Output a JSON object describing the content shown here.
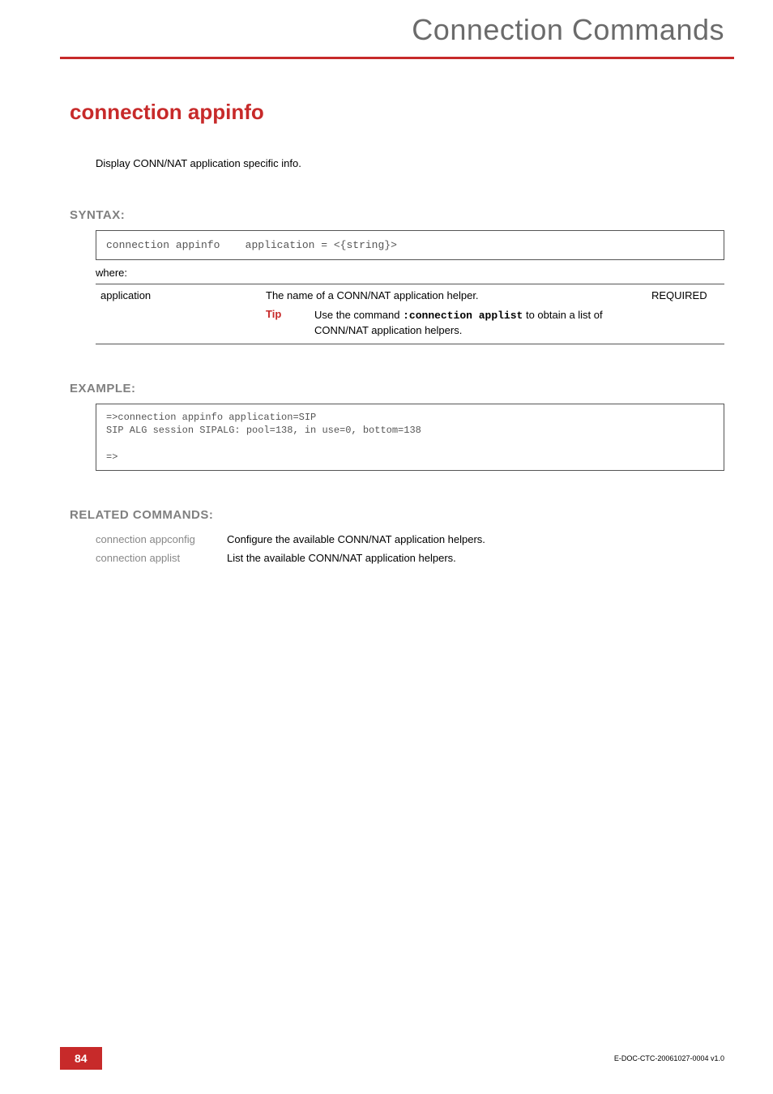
{
  "header": {
    "title": "Connection Commands"
  },
  "h1": "connection appinfo",
  "intro": "Display CONN/NAT application specific info.",
  "syntax": {
    "label": "SYNTAX:",
    "command": "connection appinfo",
    "args": "application = <{string}>",
    "where": "where:"
  },
  "param": {
    "name": "application",
    "desc": "The name of a CONN/NAT application helper.",
    "required": "REQUIRED",
    "tip_label": "Tip",
    "tip_pre": "Use the command ",
    "tip_cmd1": ":connection applist",
    "tip_post": " to obtain a list of CONN/NAT application helpers."
  },
  "example": {
    "label": "EXAMPLE:",
    "text": "=>connection appinfo application=SIP\nSIP ALG session SIPALG: pool=138, in use=0, bottom=138\n\n=>"
  },
  "related": {
    "label": "RELATED COMMANDS:",
    "rows": [
      {
        "cmd": "connection appconfig",
        "desc": "Configure the available CONN/NAT application helpers."
      },
      {
        "cmd": "connection applist",
        "desc": "List the available CONN/NAT application helpers."
      }
    ]
  },
  "footer": {
    "page": "84",
    "docid": "E-DOC-CTC-20061027-0004 v1.0"
  }
}
